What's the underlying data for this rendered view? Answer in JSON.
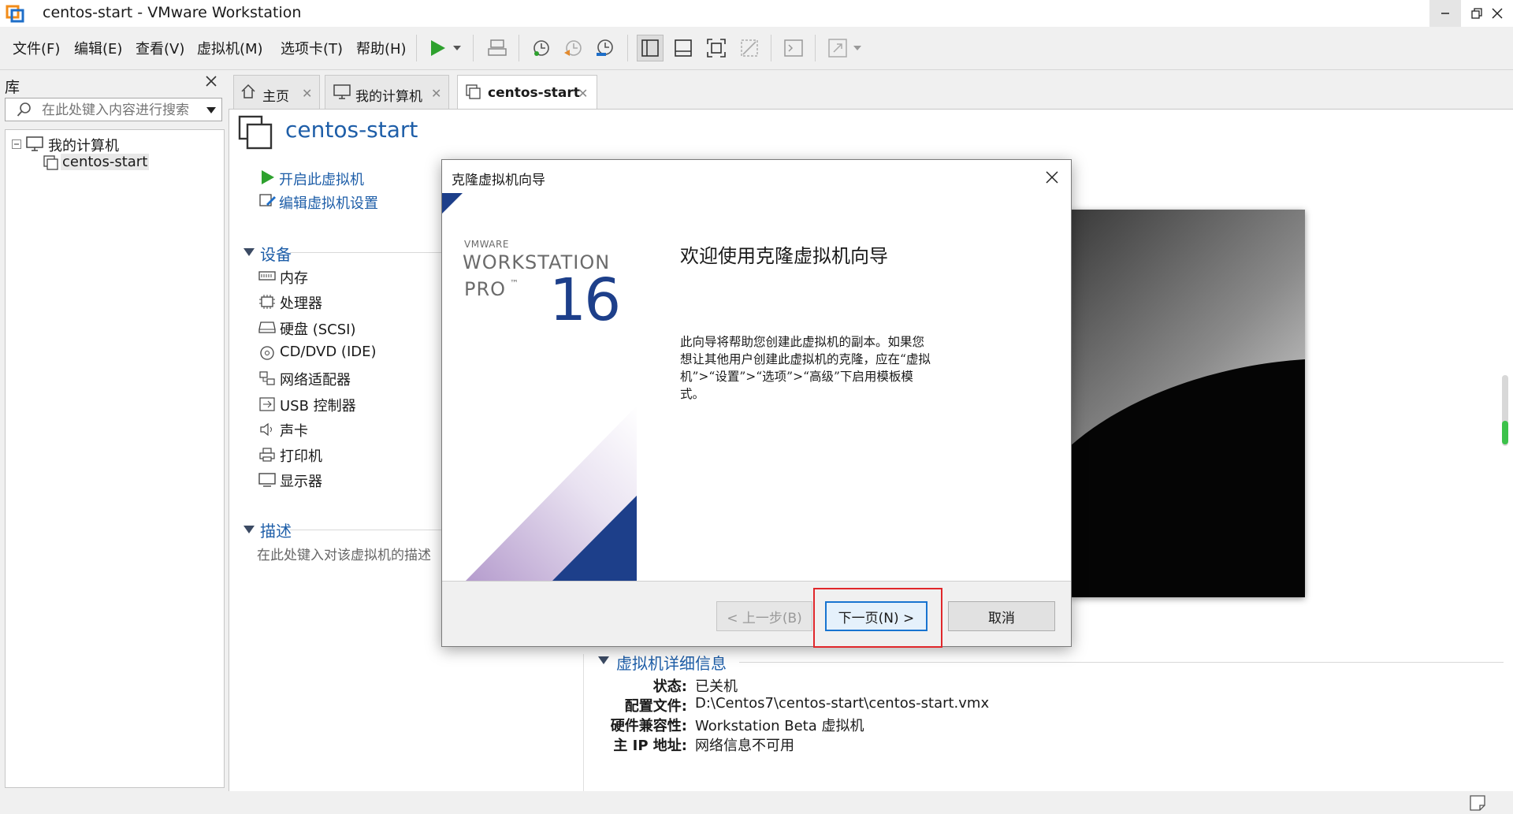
{
  "window": {
    "title": "centos-start - VMware Workstation"
  },
  "menu": {
    "file": "文件(F)",
    "edit": "编辑(E)",
    "view": "查看(V)",
    "vm": "虚拟机(M)",
    "tabs": "选项卡(T)",
    "help": "帮助(H)"
  },
  "library": {
    "title": "库",
    "search_placeholder": "在此处键入内容进行搜索",
    "tree": {
      "root": "我的计算机",
      "child": "centos-start"
    }
  },
  "tabs": [
    {
      "label": "主页"
    },
    {
      "label": "我的计算机"
    },
    {
      "label": "centos-start"
    }
  ],
  "vm": {
    "name": "centos-start",
    "actions": {
      "power_on": "开启此虚拟机",
      "edit_settings": "编辑虚拟机设置"
    },
    "devices_heading": "设备",
    "devices": [
      {
        "label": "内存",
        "icon": "memory-icon"
      },
      {
        "label": "处理器",
        "icon": "cpu-icon"
      },
      {
        "label": "硬盘 (SCSI)",
        "icon": "harddisk-icon"
      },
      {
        "label": "CD/DVD (IDE)",
        "icon": "cdrom-icon"
      },
      {
        "label": "网络适配器",
        "icon": "network-icon"
      },
      {
        "label": "USB 控制器",
        "icon": "usb-icon"
      },
      {
        "label": "声卡",
        "icon": "sound-icon"
      },
      {
        "label": "打印机",
        "icon": "printer-icon"
      },
      {
        "label": "显示器",
        "icon": "display-icon"
      }
    ],
    "description_heading": "描述",
    "description_placeholder": "在此处键入对该虚拟机的描述",
    "details": {
      "heading": "虚拟机详细信息",
      "rows": [
        {
          "key": "状态:",
          "value": "已关机"
        },
        {
          "key": "配置文件:",
          "value": "D:\\Centos7\\centos-start\\centos-start.vmx"
        },
        {
          "key": "硬件兼容性:",
          "value": "Workstation Beta 虚拟机"
        },
        {
          "key": "主 IP 地址:",
          "value": "网络信息不可用"
        }
      ]
    }
  },
  "dialog": {
    "title": "克隆虚拟机向导",
    "brand": {
      "vendor": "VMWARE",
      "product": "WORKSTATION",
      "edition": "PRO",
      "tm": "™",
      "version": "16"
    },
    "heading": "欢迎使用克隆虚拟机向导",
    "description": "此向导将帮助您创建此虚拟机的副本。如果您想让其他用户创建此虚拟机的克隆，应在“虚拟机”>“设置”>“选项”>“高级”下启用模板模式。",
    "buttons": {
      "back": "< 上一步(B)",
      "next": "下一页(N) >",
      "cancel": "取消"
    }
  },
  "colors": {
    "link_blue": "#1e5ea8",
    "play_green": "#2ea12e",
    "highlight_red": "#e0272b",
    "brand_navy": "#1d3f8a"
  }
}
